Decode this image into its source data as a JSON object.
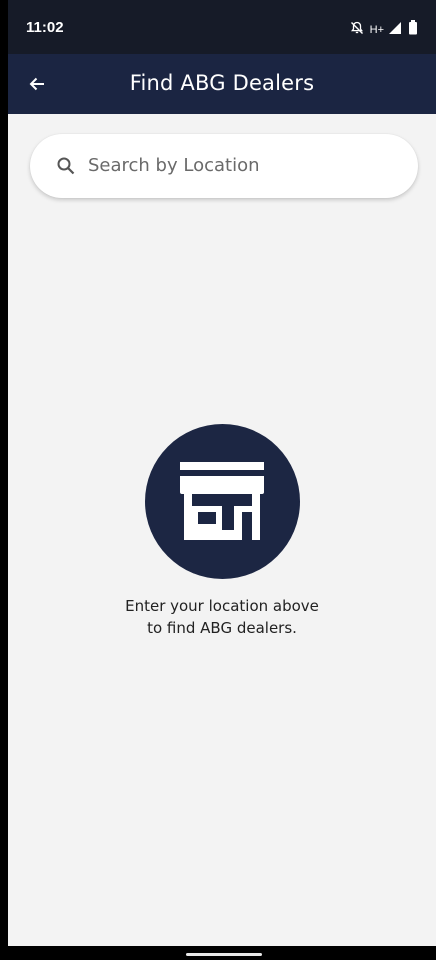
{
  "status_bar": {
    "time": "11:02",
    "network": "H+",
    "icons": [
      "notifications-off-icon",
      "signal-icon",
      "battery-icon"
    ]
  },
  "app_bar": {
    "title": "Find ABG Dealers",
    "back_icon": "arrow-left-icon"
  },
  "search": {
    "placeholder": "Search by Location",
    "icon": "search-icon"
  },
  "empty_state": {
    "icon": "store-icon",
    "line1": "Enter your location above",
    "line2": "to find ABG dealers."
  },
  "colors": {
    "status_bar": "#161b28",
    "app_bar": "#1b2542",
    "accent_circle": "#1c2643",
    "background": "#f3f3f3"
  }
}
